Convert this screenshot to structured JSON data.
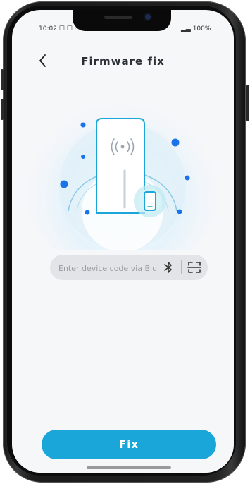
{
  "header": {
    "title": "Firmware fix",
    "back_icon": "chevron-left-icon"
  },
  "status_bar": {
    "left": "10:02 ☐ ☐ ···",
    "right": "▂▃ 100%"
  },
  "hero": {
    "device_icon": "wireless-reader-icon",
    "phone_icon": "smartphone-icon",
    "accent_color": "#1aa6d8",
    "dot_color": "#1a73e8"
  },
  "device_input": {
    "placeholder": "Enter device code via Bluetooth or Scan",
    "value": "",
    "bluetooth_icon": "bluetooth-icon",
    "scan_icon": "scan-icon"
  },
  "actions": {
    "fix_label": "Fix"
  },
  "colors": {
    "background": "#f6f7f9",
    "primary": "#1aa6d8",
    "title": "#2b2f36"
  }
}
